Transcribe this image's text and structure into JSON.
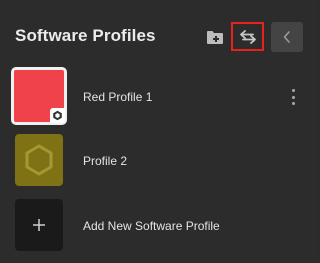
{
  "header": {
    "title": "Software Profiles",
    "icons": {
      "add_folder": "folder-plus-icon",
      "swap": "swap-arrows-icon",
      "back": "chevron-left-icon"
    },
    "highlight_color": "#e8221b"
  },
  "profiles": [
    {
      "label": "Red Profile 1",
      "color": "#f0424a",
      "selected": true,
      "icon": "hexagon-badge-icon"
    },
    {
      "label": "Profile 2",
      "color": "#7e7214",
      "selected": false,
      "icon": "hexagon-outline-icon"
    }
  ],
  "add_new": {
    "label": "Add New Software Profile",
    "icon": "plus-icon"
  }
}
